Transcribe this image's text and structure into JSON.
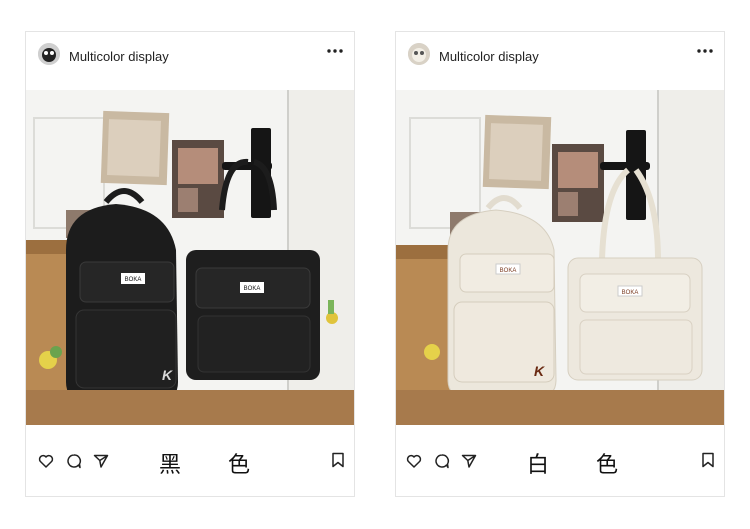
{
  "posts": [
    {
      "username": "Multicolor display",
      "color_label": "黑 色",
      "bag_badge": "BOKA",
      "bag_letter": "K",
      "bag_color": "#1c1c1c"
    },
    {
      "username": "Multicolor display",
      "color_label": "白 色",
      "bag_badge": "BOKA",
      "bag_letter": "K",
      "bag_color": "#ece7dc"
    }
  ],
  "icons": [
    "more-icon",
    "heart-icon",
    "comment-icon",
    "share-icon",
    "bookmark-icon"
  ]
}
